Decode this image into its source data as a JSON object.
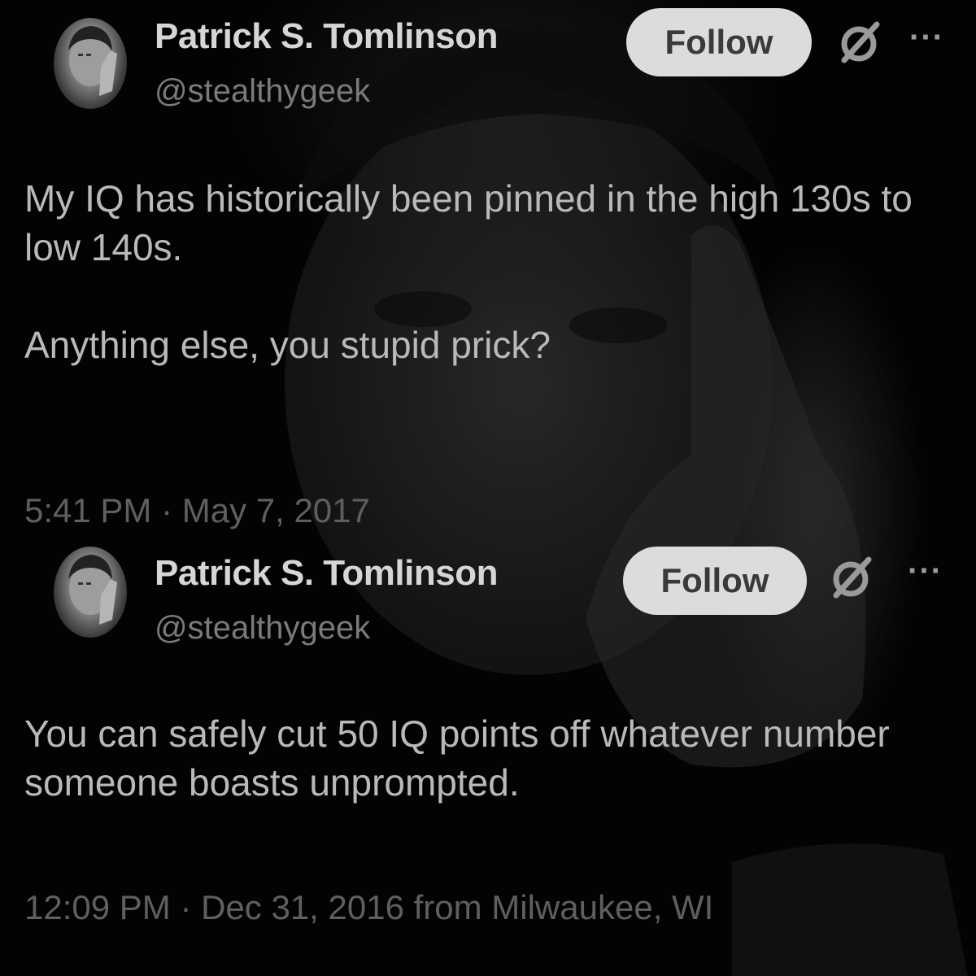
{
  "tweets": [
    {
      "display_name": "Patrick S. Tomlinson",
      "handle": "@stealthygeek",
      "follow_label": "Follow",
      "grok_icon": "slashed-circle-icon",
      "more_icon": "more-dots-icon",
      "more_glyph": "···",
      "text_paragraphs": [
        "My IQ has historically been pinned in the high 130s to low 140s.",
        "Anything else, you stupid prick?"
      ],
      "timestamp": "5:41 PM · May 7, 2017"
    },
    {
      "display_name": "Patrick S. Tomlinson",
      "handle": "@stealthygeek",
      "follow_label": "Follow",
      "grok_icon": "slashed-circle-icon",
      "more_icon": "more-dots-icon",
      "more_glyph": "···",
      "text_paragraphs": [
        "You can safely cut 50 IQ points off whatever number someone boasts unprompted."
      ],
      "timestamp": "12:09 PM · Dec 31, 2016 from Milwaukee, WI"
    }
  ],
  "colors": {
    "background": "#000000",
    "display_name": "#d6d6d6",
    "handle": "#7a7a7a",
    "body_text": "#b9b9b9",
    "timestamp": "#5f5f5f",
    "follow_button_bg": "#dcdcdc",
    "follow_button_text": "#3a3a3a"
  }
}
